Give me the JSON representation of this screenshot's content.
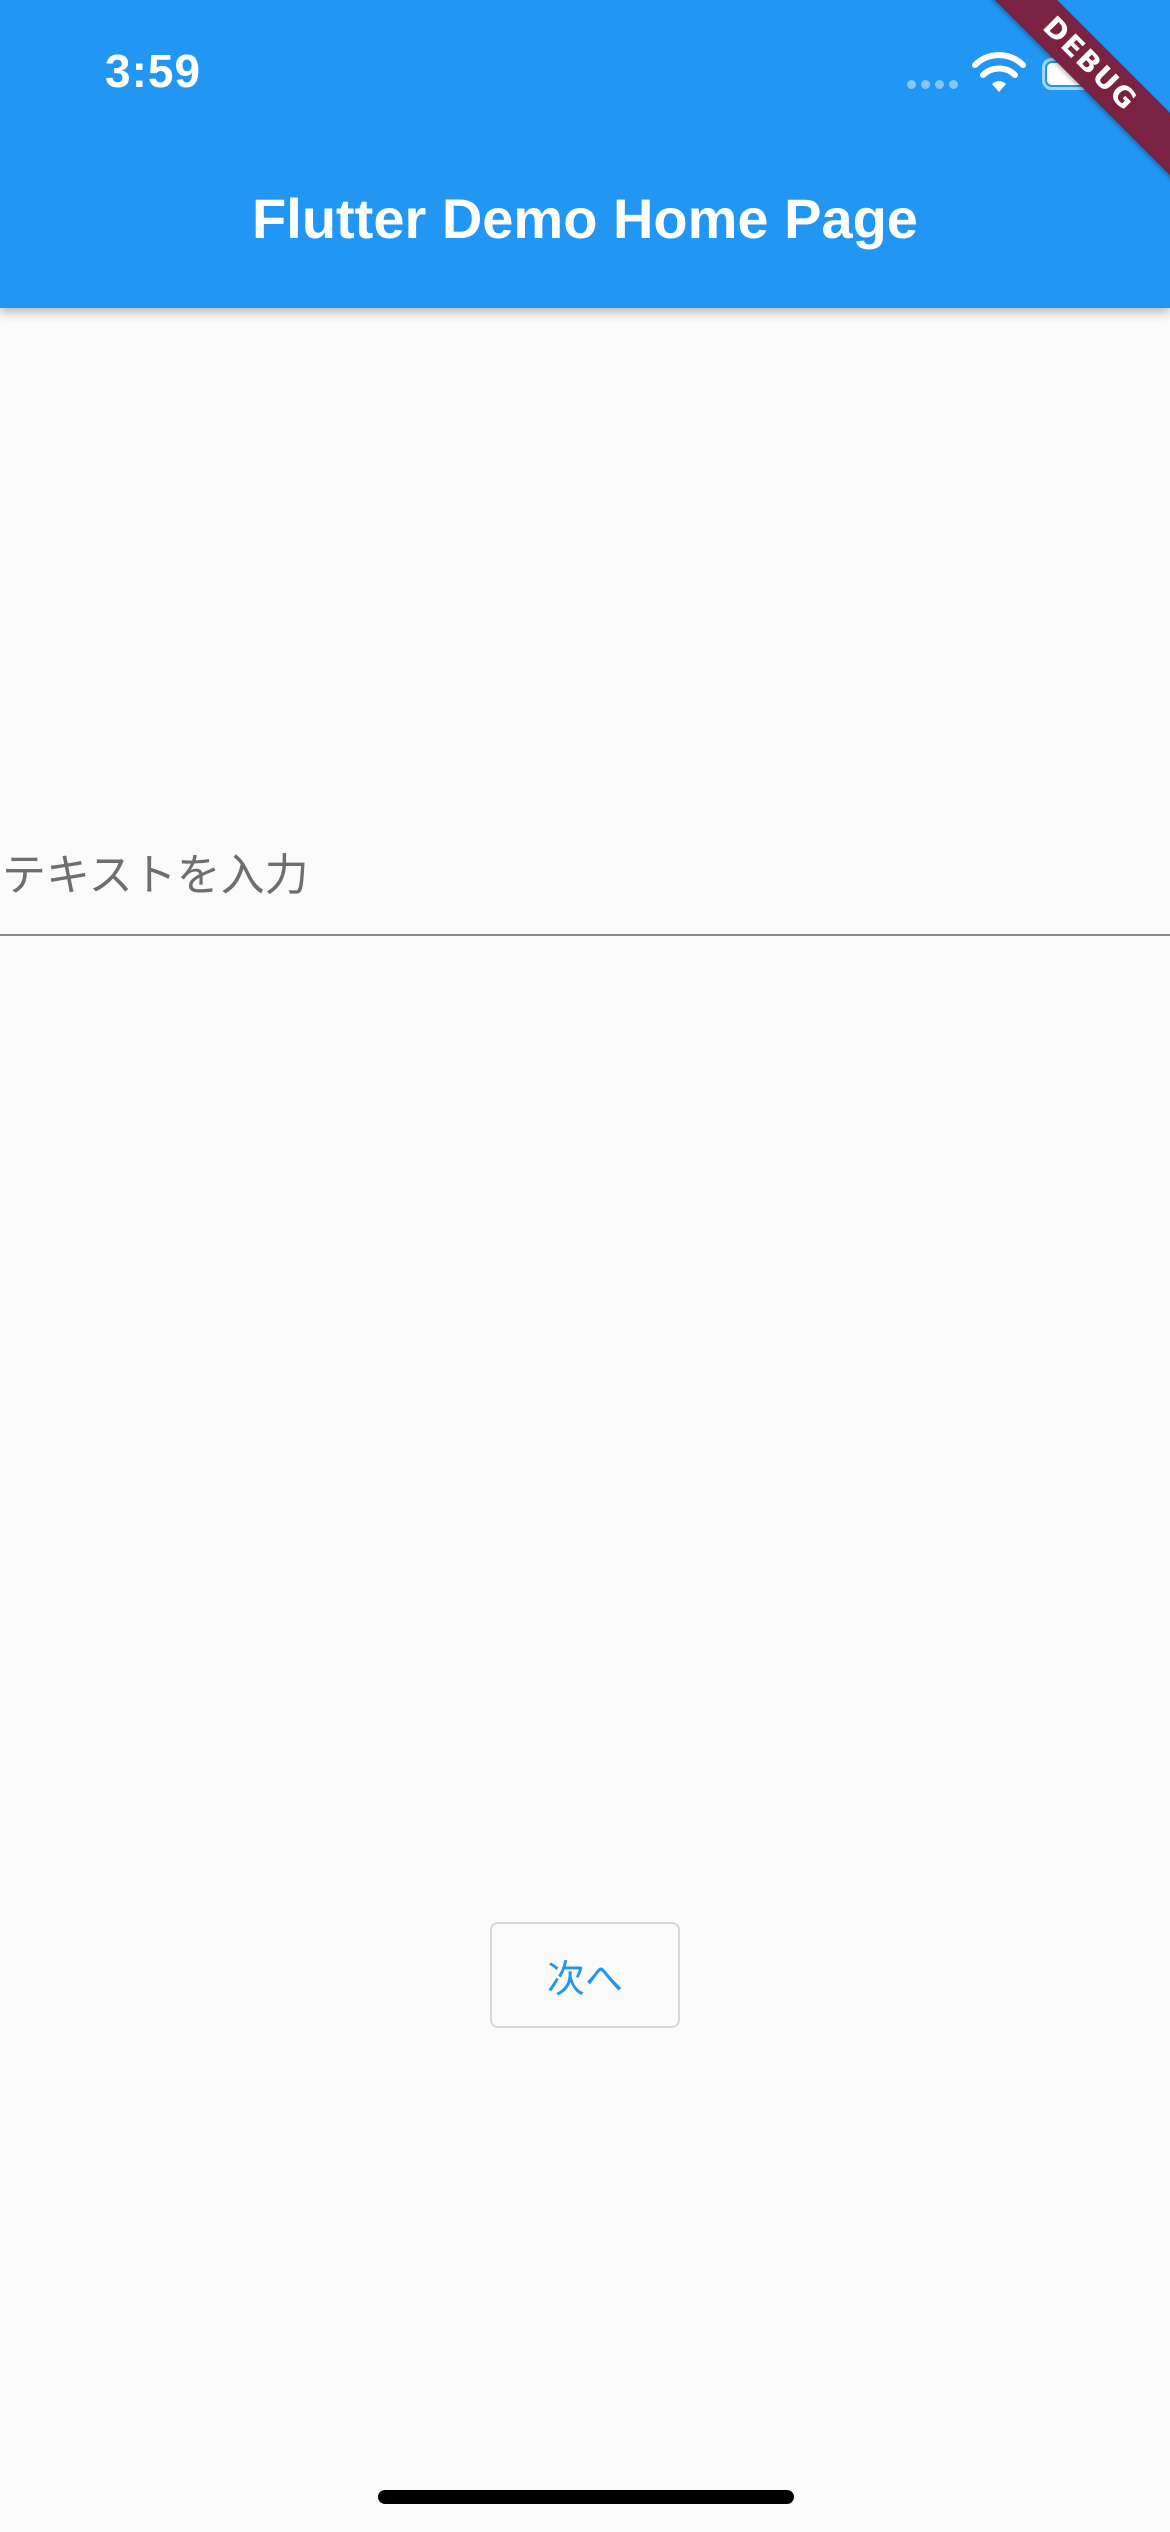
{
  "status_bar": {
    "time": "3:59"
  },
  "app_bar": {
    "title": "Flutter Demo Home Page",
    "color": "#2196f3"
  },
  "debug_banner": {
    "label": "DEBUG",
    "color": "#7a2241"
  },
  "form": {
    "text_field": {
      "placeholder": "テキストを入力",
      "value": ""
    },
    "next_button": {
      "label": "次へ",
      "color": "#2196f3"
    }
  },
  "icons": {
    "signal": "signal-dots-icon",
    "wifi": "wifi-icon",
    "battery": "battery-icon"
  }
}
